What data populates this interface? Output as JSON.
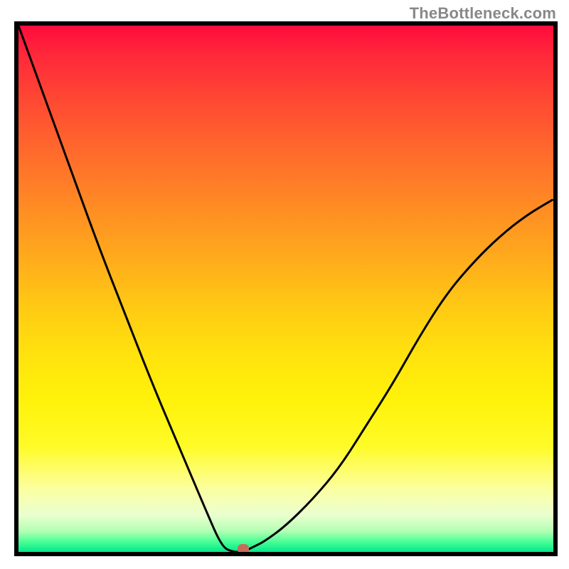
{
  "watermark": "TheBottleneck.com",
  "chart_data": {
    "type": "line",
    "title": "",
    "xlabel": "",
    "ylabel": "",
    "xlim": [
      0,
      100
    ],
    "ylim": [
      0,
      100
    ],
    "grid": false,
    "series": [
      {
        "name": "bottleneck-curve",
        "x": [
          0,
          5,
          10,
          15,
          20,
          25,
          30,
          35,
          38,
          40,
          42,
          44,
          46,
          50,
          55,
          60,
          65,
          70,
          75,
          80,
          85,
          90,
          95,
          100
        ],
        "y": [
          100,
          86,
          72,
          58,
          45,
          32,
          20,
          8,
          1,
          0,
          0,
          1,
          2,
          5,
          10,
          16,
          24,
          32,
          41,
          49,
          55,
          60,
          64,
          67
        ]
      }
    ],
    "marker": {
      "x": 42,
      "y": 0.5
    },
    "colors": {
      "curve": "#000000",
      "marker": "#c86a5a",
      "gradient_top": "#ff0b3d",
      "gradient_mid": "#ffe10e",
      "gradient_bottom": "#00e88a",
      "border": "#000000"
    }
  }
}
